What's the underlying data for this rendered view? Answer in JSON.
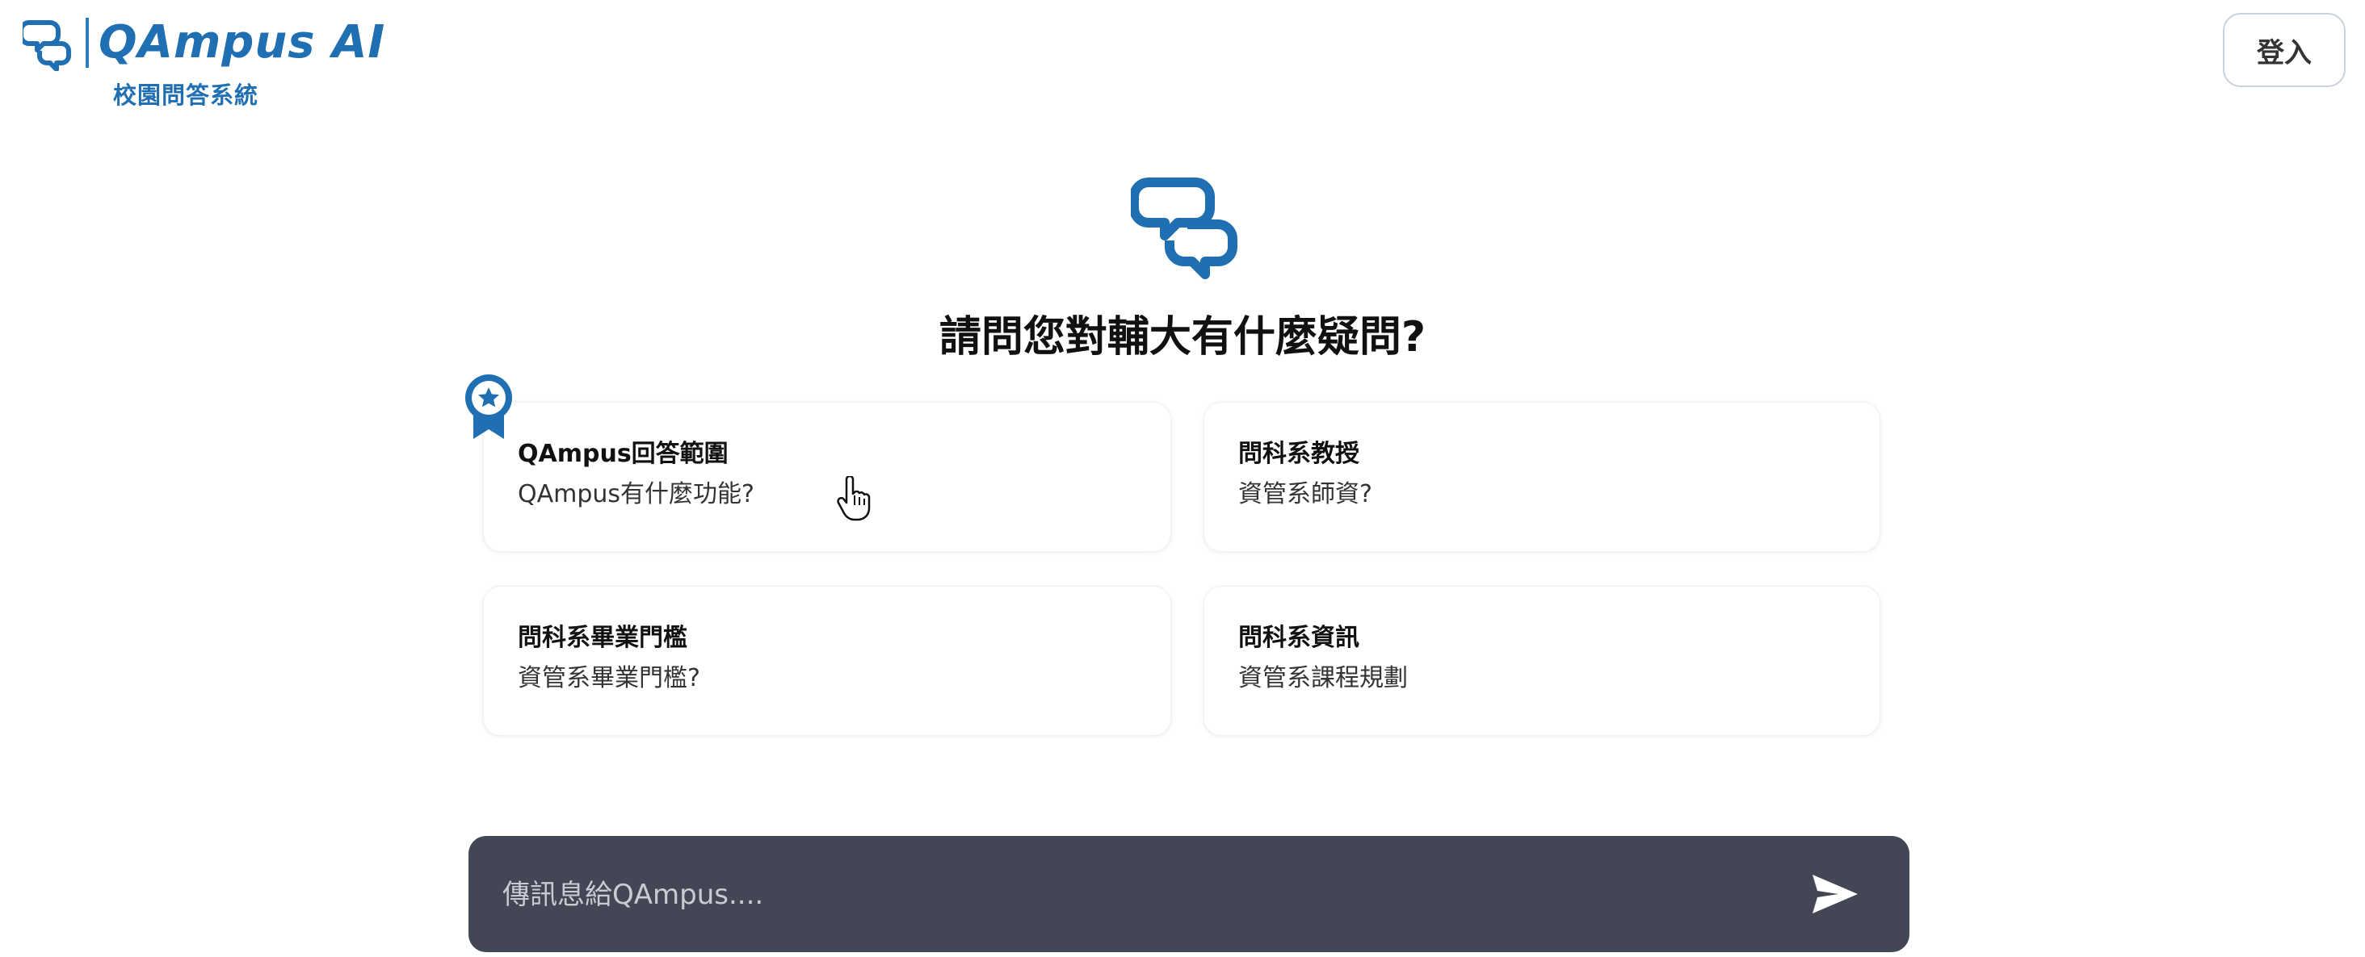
{
  "header": {
    "app_name": "QAmpus AI",
    "subtitle": "校園問答系統",
    "login_label": "登入"
  },
  "hero": {
    "title": "請問您對輔大有什麼疑問?"
  },
  "suggestions": [
    {
      "title": "QAmpus回答範圍",
      "question": "QAmpus有什麼功能?"
    },
    {
      "title": "問科系教授",
      "question": "資管系師資?"
    },
    {
      "title": "問科系畢業門檻",
      "question": "資管系畢業門檻?"
    },
    {
      "title": "問科系資訊",
      "question": "資管系課程規劃"
    }
  ],
  "chat": {
    "placeholder": "傳訊息給QAmpus....",
    "value": ""
  },
  "colors": {
    "brand": "#1f6fb2",
    "chat_bar": "#434654",
    "badge": "#1f6fb2"
  },
  "icons": {
    "logo": "chat-bubbles-icon",
    "badge": "award-ribbon-icon",
    "send": "send-arrow-icon",
    "cursor": "hand-pointer-icon"
  }
}
